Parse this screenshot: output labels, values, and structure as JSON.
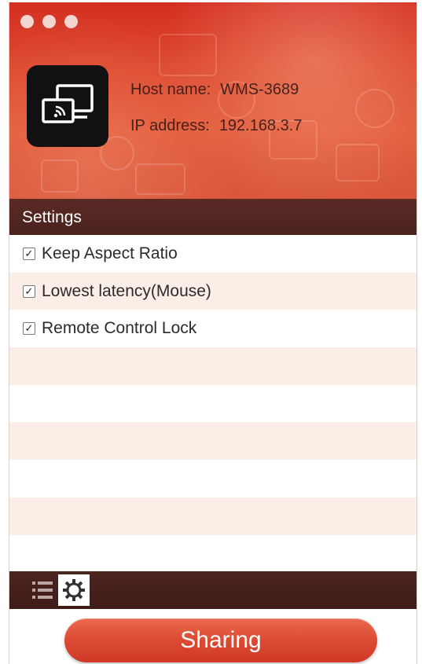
{
  "window": {
    "traffic_lights": [
      "close",
      "minimize",
      "zoom"
    ]
  },
  "header": {
    "app_icon": "screen-cast-icon",
    "host_label": "Host name:",
    "host_value": "WMS-3689",
    "ip_label": "IP address:",
    "ip_value": "192.168.3.7"
  },
  "settings": {
    "title": "Settings",
    "options": [
      {
        "label": "Keep Aspect Ratio",
        "checked": true
      },
      {
        "label": "Lowest latency(Mouse)",
        "checked": true
      },
      {
        "label": "Remote Control Lock",
        "checked": true
      }
    ]
  },
  "toolbar": {
    "list_icon": "list-icon",
    "settings_icon": "gear-icon",
    "active": "settings"
  },
  "footer": {
    "share_label": "Sharing"
  },
  "colors": {
    "header_red": "#d42f22",
    "bar_dark": "#4a221e",
    "row_alt": "#fbeee6",
    "button_red": "#dc4a33"
  }
}
